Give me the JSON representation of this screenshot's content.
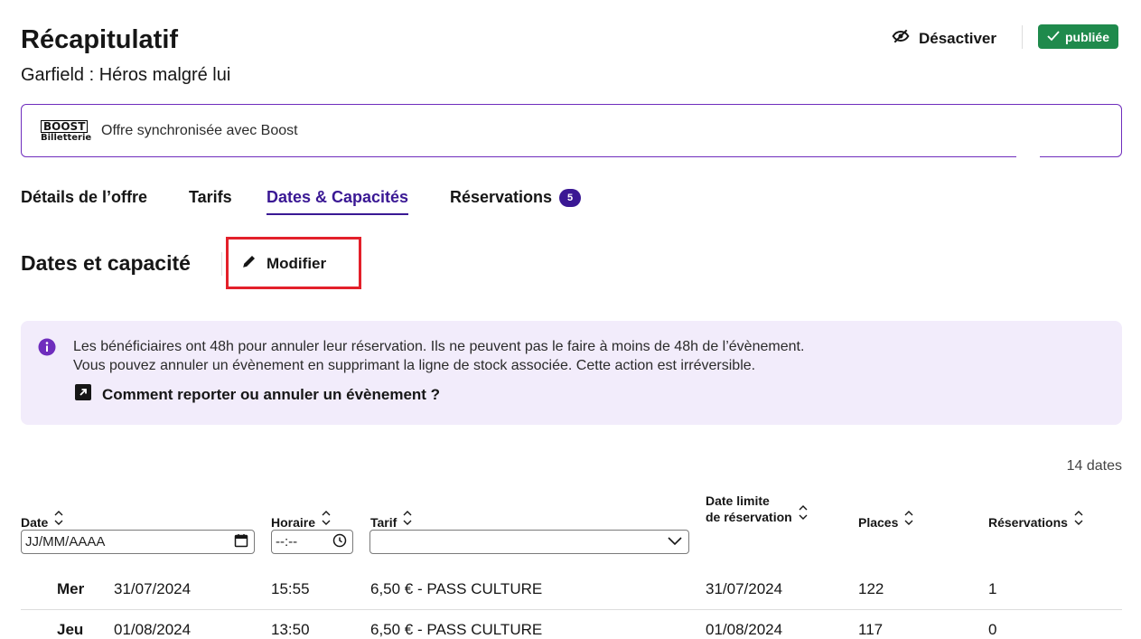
{
  "header": {
    "title": "Récapitulatif",
    "subtitle": "Garfield : Héros malgré lui",
    "deactivate_label": "Désactiver",
    "status_label": "publiée"
  },
  "sync": {
    "logo_line1": "BOOST",
    "logo_line2": "Billetterie",
    "text": "Offre synchronisée avec Boost"
  },
  "tabs": [
    {
      "label": "Détails de l’offre",
      "active": false
    },
    {
      "label": "Tarifs",
      "active": false
    },
    {
      "label": "Dates & Capacités",
      "active": true
    },
    {
      "label": "Réservations",
      "active": false,
      "count": "5"
    }
  ],
  "section": {
    "title": "Dates et capacité",
    "edit_label": "Modifier"
  },
  "info": {
    "line1": "Les bénéficiaires ont 48h pour annuler leur réservation. Ils ne peuvent pas le faire à moins de 48h de l’évènement.",
    "line2": "Vous pouvez annuler un évènement en supprimant la ligne de stock associée. Cette action est irréversible.",
    "link": "Comment reporter ou annuler un évènement ?"
  },
  "table": {
    "count_label": "14 dates",
    "headers": {
      "date": "Date",
      "time": "Horaire",
      "tariff": "Tarif",
      "deadline_line1": "Date limite",
      "deadline_line2": "de réservation",
      "places": "Places",
      "bookings": "Réservations"
    },
    "filters": {
      "date_placeholder": "JJ/MM/AAAA",
      "time_placeholder": "--:--",
      "tariff_value": ""
    },
    "rows": [
      {
        "day": "Mer",
        "date": "31/07/2024",
        "time": "15:55",
        "tariff": "6,50 € - PASS CULTURE",
        "deadline": "31/07/2024",
        "places": "122",
        "bookings": "1"
      },
      {
        "day": "Jeu",
        "date": "01/08/2024",
        "time": "13:50",
        "tariff": "6,50 € - PASS CULTURE",
        "deadline": "01/08/2024",
        "places": "117",
        "bookings": "0"
      }
    ]
  },
  "colors": {
    "accent": "#3a1894",
    "published": "#1f8a4c",
    "highlight": "#e3202a",
    "info_bg": "#f2ecfb"
  }
}
